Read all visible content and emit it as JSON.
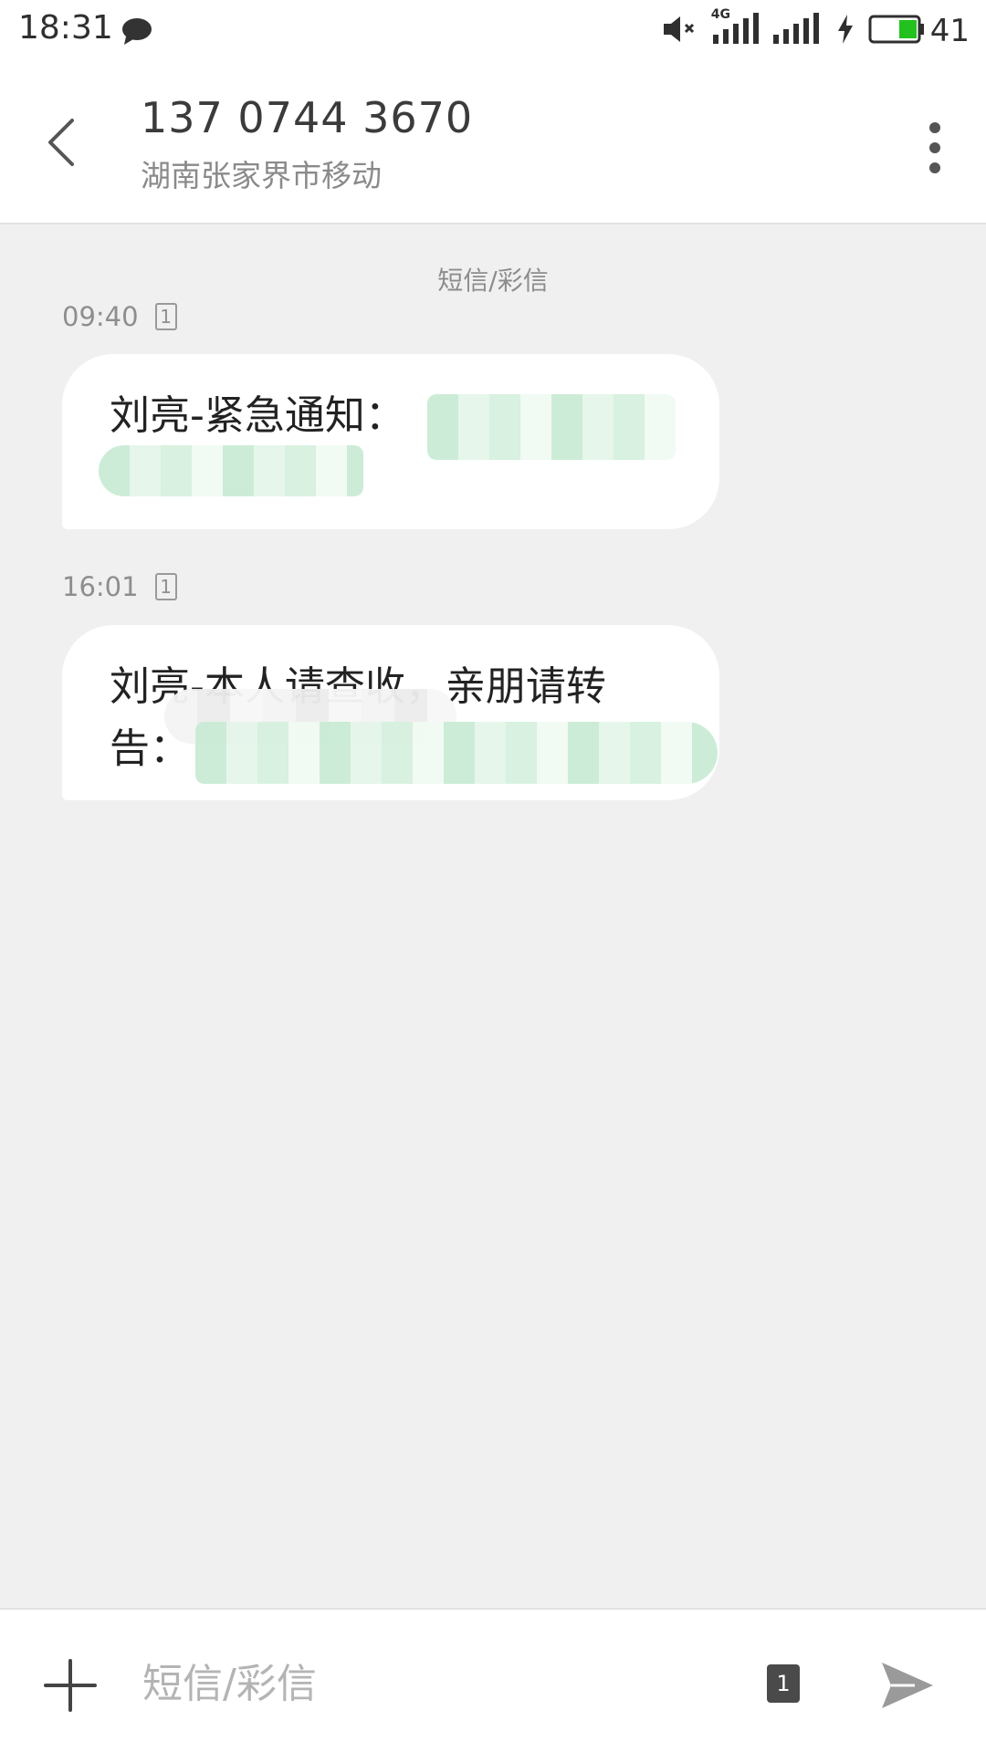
{
  "status_bar": {
    "time": "18:31",
    "network_type": "4G",
    "battery_level": "41",
    "icons": [
      "chat-bubble-icon",
      "mute-icon",
      "signal-icon",
      "signal-icon",
      "charging-icon",
      "battery-icon"
    ],
    "battery_color": "#22c11e"
  },
  "header": {
    "contact_number": "137 0744 3670",
    "contact_location": "湖南张家界市移动",
    "icons": [
      "back-arrow-icon",
      "more-vertical-icon"
    ]
  },
  "conversation": {
    "channel_label": "短信/彩信",
    "messages": [
      {
        "time": "09:40",
        "sim": "1",
        "text": "刘亮-紧急通知："
      },
      {
        "time": "16:01",
        "sim": "1",
        "text": "刘亮-本人请查收，亲朋请转告："
      }
    ]
  },
  "input_bar": {
    "placeholder": "短信/彩信",
    "sim_label": "1",
    "icons": [
      "add-icon",
      "sim-card-icon",
      "send-icon"
    ]
  },
  "colors": {
    "background": "#f0f0f0",
    "bubble": "#ffffff",
    "redaction": "#c9ebd5"
  }
}
